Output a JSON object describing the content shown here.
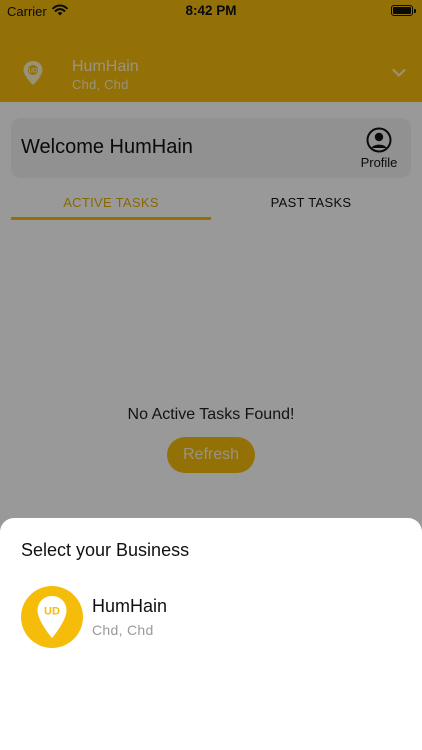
{
  "status_bar": {
    "carrier": "Carrier",
    "time": "8:42 PM"
  },
  "header": {
    "business_name": "HumHain",
    "business_location": "Chd, Chd",
    "icon": "location-pin-icon"
  },
  "welcome": {
    "text": "Welcome HumHain",
    "profile_label": "Profile"
  },
  "tabs": [
    {
      "label": "ACTIVE TASKS",
      "active": true
    },
    {
      "label": "PAST TASKS",
      "active": false
    }
  ],
  "empty_state": {
    "message": "No Active Tasks Found!",
    "refresh_label": "Refresh"
  },
  "sheet": {
    "title": "Select your Business",
    "items": [
      {
        "name": "HumHain",
        "location": "Chd, Chd",
        "logo_text": "UD"
      }
    ]
  },
  "colors": {
    "accent": "#f5bd0a",
    "active_tab": "#e3ae08"
  }
}
